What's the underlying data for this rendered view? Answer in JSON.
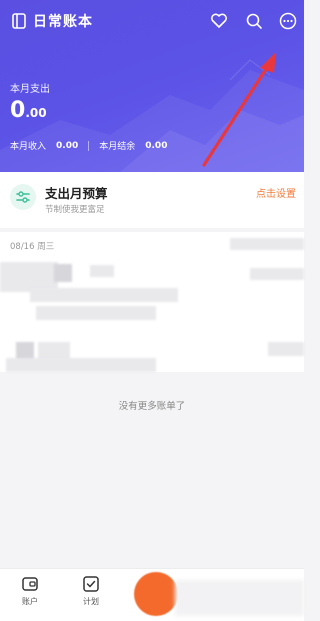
{
  "header": {
    "title": "日常账本",
    "month_expense_label": "本月支出",
    "month_expense_int": "0",
    "month_expense_dec": ".00",
    "month_income_label": "本月收入",
    "month_income_value": "0.00",
    "month_balance_label": "本月结余",
    "month_balance_value": "0.00"
  },
  "budget": {
    "title": "支出月预算",
    "subtitle": "节制使我更富足",
    "action": "点击设置"
  },
  "list": {
    "date_label": "08/16 周三",
    "end_text": "没有更多账单了"
  },
  "bottom_nav": {
    "tabs": [
      {
        "label": "账户",
        "icon": "wallet-icon"
      },
      {
        "label": "计划",
        "icon": "check-square-icon"
      }
    ]
  },
  "colors": {
    "header_bg": "#5b52e6",
    "accent_orange": "#f47a3a",
    "arrow_red": "#e8383d"
  }
}
